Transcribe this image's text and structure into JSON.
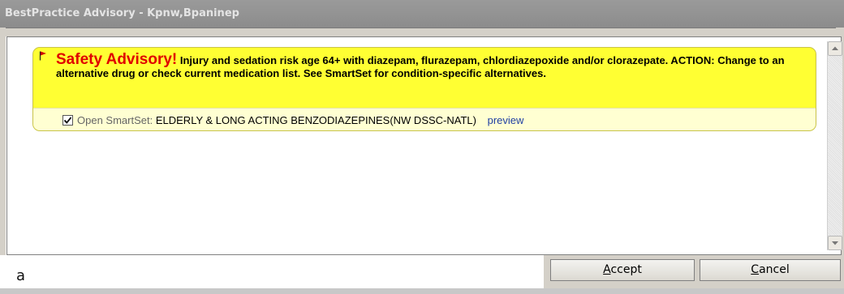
{
  "window": {
    "title": "BestPractice Advisory  - Kpnw,Bpaninep"
  },
  "advisory": {
    "headline": "Safety Advisory!",
    "message": "Injury and sedation risk age 64+ with diazepam, flurazepam, chlordiazepoxide and/or clorazepate. ACTION: Change to an alternative drug or check current medication list. See SmartSet for condition-specific alternatives.",
    "flag_icon": "red-flag-icon",
    "smartset": {
      "checked": true,
      "label": "Open SmartSet:",
      "name": "ELDERLY & LONG ACTING BENZODIAZEPINES(NW DSSC-NATL)",
      "preview_link": "preview"
    }
  },
  "footer": {
    "letter": "a",
    "accept_first": "A",
    "accept_rest": "ccept",
    "cancel_first": "C",
    "cancel_rest": "ancel"
  },
  "colors": {
    "advisory_bg": "#ffff33",
    "headline": "#e00000",
    "link": "#1f3fa3"
  }
}
